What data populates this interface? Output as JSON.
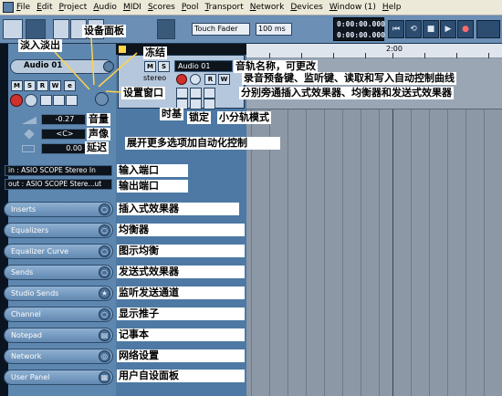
{
  "menubar": {
    "items": [
      "File",
      "Edit",
      "Project",
      "Audio",
      "MIDI",
      "Scores",
      "Pool",
      "Transport",
      "Network",
      "Devices",
      "Window (1)",
      "Help"
    ]
  },
  "toolbar": {
    "touch_fader": "Touch Fader",
    "preroll": "100 ms",
    "time_primary": "0:00:00.000",
    "time_secondary": "0:00:00.000"
  },
  "ruler": {
    "marker": "2:00"
  },
  "track": {
    "name": "Audio 01",
    "header_name": "Audio 01",
    "channel_type": "stereo"
  },
  "inspector": {
    "volume": "-0.27",
    "pan": "<C>",
    "delay": "0.00",
    "input": "in : ASIO SCOPE Stereo In",
    "output": "out : ASIO SCOPE Stere...ut"
  },
  "sections": [
    {
      "label": "Inserts",
      "icon": "bypass-icon"
    },
    {
      "label": "Equalizers",
      "icon": "bypass-icon"
    },
    {
      "label": "Equalizer Curve",
      "icon": "bypass-icon"
    },
    {
      "label": "Sends",
      "icon": "bypass-icon"
    },
    {
      "label": "Studio Sends",
      "icon": "star-icon"
    },
    {
      "label": "Channel",
      "icon": "bypass-icon"
    },
    {
      "label": "Notepad",
      "icon": "notepad-icon"
    },
    {
      "label": "Network",
      "icon": "network-icon"
    },
    {
      "label": "User Panel",
      "icon": "panel-icon"
    }
  ],
  "annotations": {
    "fade": "淡入淡出",
    "device_panel": "设备面板",
    "freeze": "冻结",
    "track_name": "音轨名称，可更改",
    "record_keys": "录音预备键、监听键、读取和写入自动控制曲线",
    "settings_window": "设置窗口",
    "side_chain": "分别旁通插入式效果器、均衡器和发送式效果器",
    "timebase": "时基",
    "lock": "锁定",
    "lane_mode": "小分轨模式",
    "volume": "音量",
    "pan": "声像",
    "delay": "延迟",
    "expand": "展开更多选项加自动化控制",
    "input_port": "输入端口",
    "output_port": "输出端口",
    "inserts": "插入式效果器",
    "equalizers": "均衡器",
    "eq_curve": "图示均衡",
    "sends": "发送式效果器",
    "studio_sends": "监听发送通道",
    "channel": "显示推子",
    "notepad": "记事本",
    "network": "网络设置",
    "user_panel": "用户自设面板"
  },
  "colors": {
    "inspector_bg": "#5e87b0",
    "project_bg": "#8c98a6",
    "record_red": "#d0312d"
  }
}
